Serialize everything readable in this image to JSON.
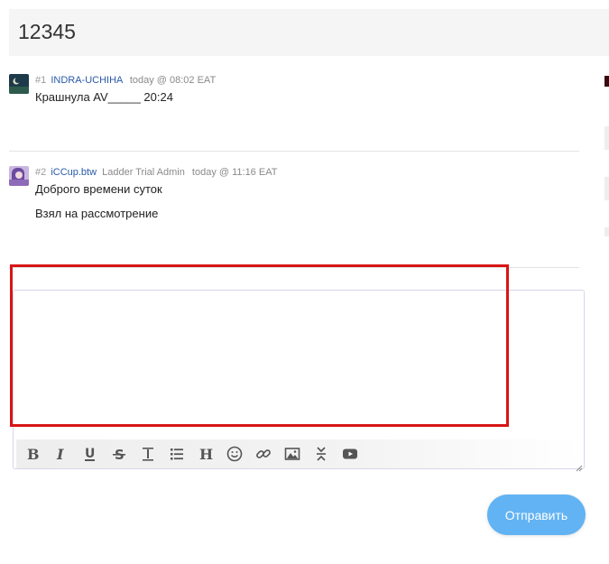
{
  "thread": {
    "title": "12345"
  },
  "posts": [
    {
      "number": "#1",
      "author": "INDRA-UCHIHA",
      "role": "",
      "time": "today @ 08:02 EAT",
      "lines": [
        "Крашнула AV_____ 20:24"
      ]
    },
    {
      "number": "#2",
      "author": "iCCup.btw",
      "role": "Ladder Trial Admin",
      "time": "today @ 11:16 EAT",
      "lines": [
        "Доброго времени суток",
        "Взял на рассмотрение"
      ]
    }
  ],
  "editor": {
    "placeholder": "",
    "toolbar": [
      "bold-icon",
      "italic-icon",
      "underline-icon",
      "strikethrough-icon",
      "horizontal-rule-icon",
      "list-icon",
      "heading-icon",
      "emoji-icon",
      "link-icon",
      "image-icon",
      "collapse-icon",
      "youtube-icon"
    ]
  },
  "actions": {
    "send_label": "Отправить"
  },
  "colors": {
    "author_link": "#2a5aa8",
    "send_button": "#62b3f3",
    "highlight": "#d81515"
  }
}
